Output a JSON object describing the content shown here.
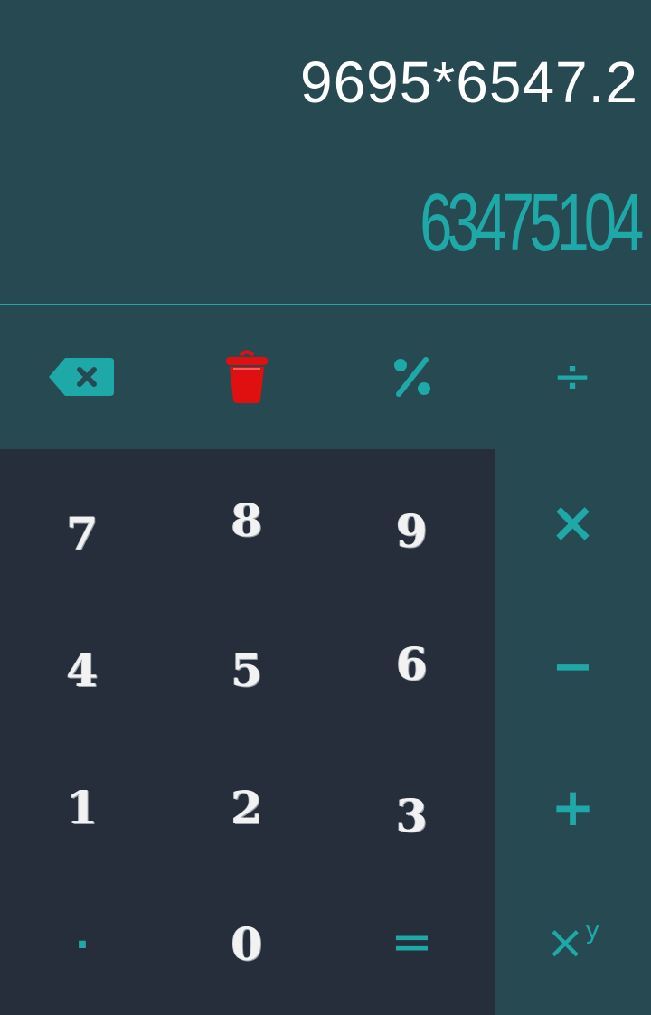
{
  "display": {
    "expression": "9695*6547.2",
    "result": "63475104"
  },
  "function_row": {
    "backspace_icon": "backspace-icon",
    "clear_icon": "trash-icon",
    "percent": "%",
    "divide": "÷"
  },
  "keypad": {
    "rows": [
      [
        "7",
        "8",
        "9"
      ],
      [
        "4",
        "5",
        "6"
      ],
      [
        "1",
        "2",
        "3"
      ],
      [
        "·",
        "0",
        "="
      ]
    ]
  },
  "operators": {
    "multiply": "×",
    "subtract": "−",
    "add": "+",
    "power_base": "×",
    "power_exp": "y"
  },
  "colors": {
    "display_bg": "#274a52",
    "numpad_bg": "#262d3b",
    "accent": "#1fa8a8",
    "clear": "#e01010",
    "text": "#ffffff"
  }
}
